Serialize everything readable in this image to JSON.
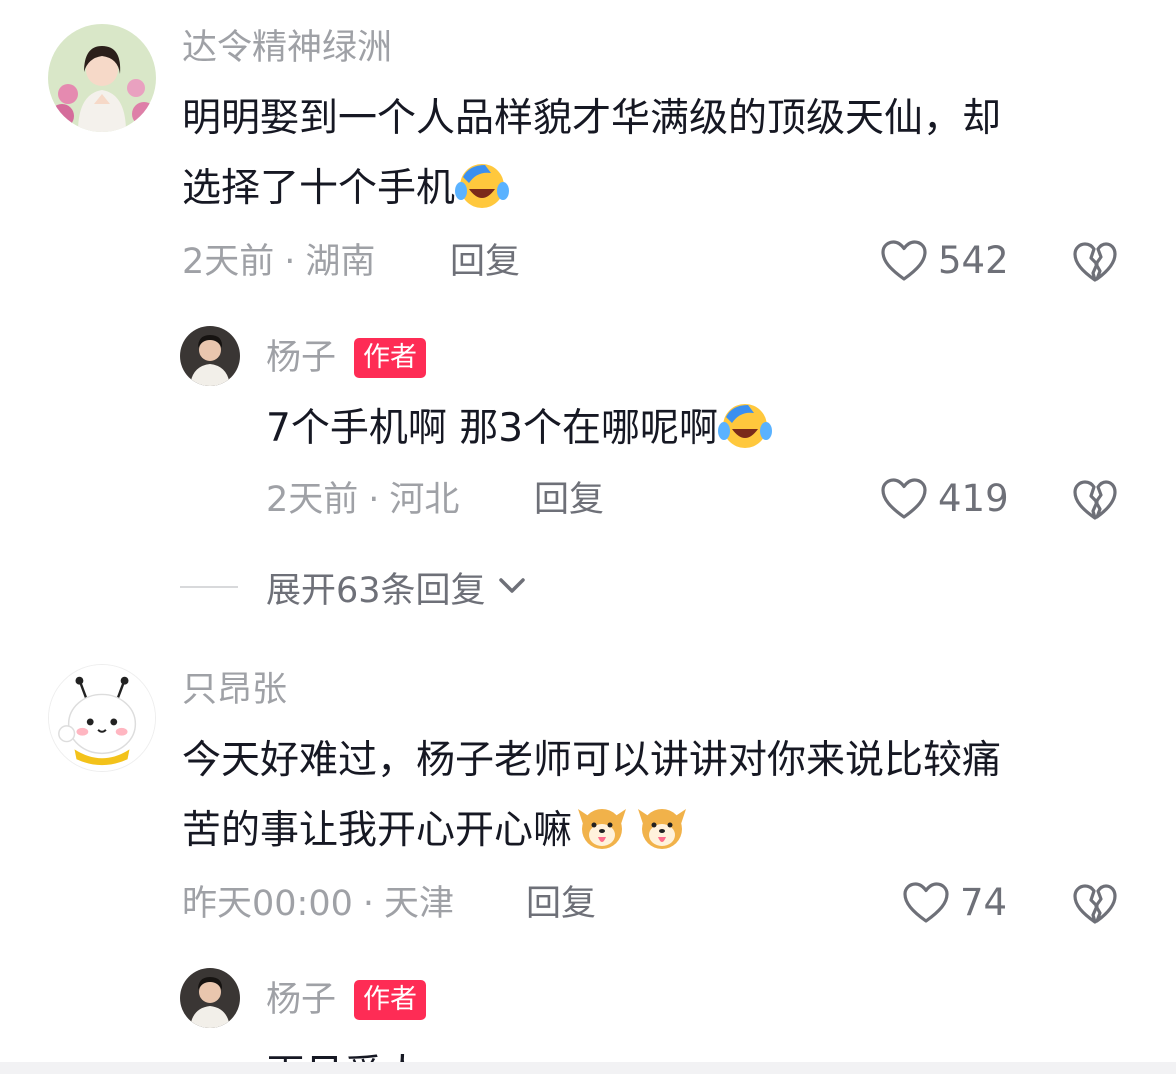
{
  "comments": [
    {
      "user": "达令精神绿洲",
      "text_line1": "明明娶到一个人品样貌才华满级的顶级天仙，却",
      "text_line2": "选择了十个手机",
      "emoji": "laughing-crying-emoji",
      "time": "2天前",
      "location": "湖南",
      "reply": "回复",
      "likes": "542",
      "replies": [
        {
          "user": "杨子",
          "tag": "作者",
          "text": "7个手机啊 那3个在哪呢啊",
          "emoji": "laughing-crying-emoji",
          "time": "2天前",
          "location": "河北",
          "reply": "回复",
          "likes": "419"
        }
      ],
      "expand": "展开63条回复"
    },
    {
      "user": "只昂张",
      "text_line1": "今天好难过，杨子老师可以讲讲对你来说比较痛",
      "text_line2": "苦的事让我开心开心嘛",
      "emoji": "shiba-dog-emoji",
      "time": "昨天00:00",
      "location": "天津",
      "reply": "回复",
      "likes": "74",
      "replies": [
        {
          "user": "杨子",
          "tag": "作者",
          "text": "再见爱人"
        }
      ]
    }
  ],
  "separator": "·",
  "colors": {
    "primary_text": "#161823",
    "secondary_text": "#9fa1a6",
    "author_tag_bg": "#fe2c55",
    "icon_gray": "#6e7078"
  }
}
